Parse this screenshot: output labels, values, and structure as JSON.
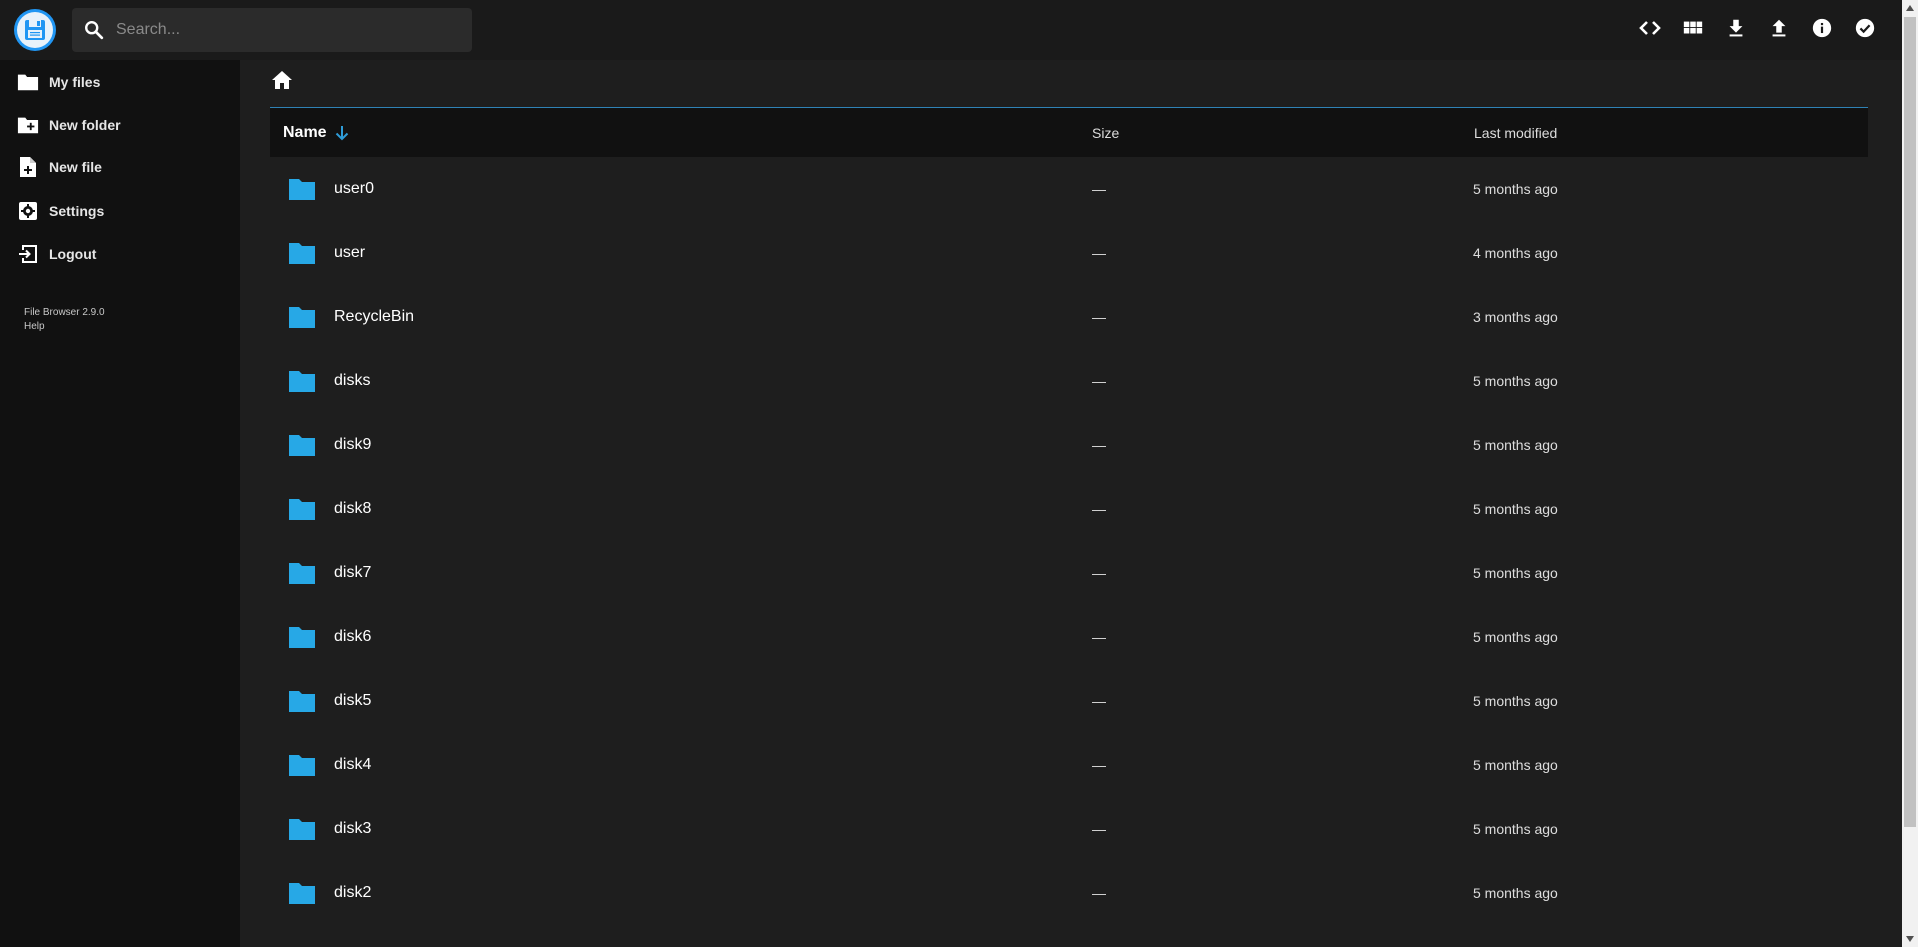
{
  "app": {
    "logo_icon": "floppy-disk-logo",
    "accent_color": "#2196f3",
    "folder_color": "#27a8e6"
  },
  "search": {
    "placeholder": "Search..."
  },
  "header_actions": [
    {
      "name": "toggle-code-view",
      "icon": "code-icon"
    },
    {
      "name": "switch-view",
      "icon": "grid-view-icon"
    },
    {
      "name": "download",
      "icon": "download-icon"
    },
    {
      "name": "upload",
      "icon": "upload-icon"
    },
    {
      "name": "info",
      "icon": "info-icon"
    },
    {
      "name": "select-multiple",
      "icon": "check-circle-icon"
    }
  ],
  "sidebar": {
    "items": [
      {
        "label": "My files",
        "icon": "folder-icon"
      },
      {
        "label": "New folder",
        "icon": "new-folder-icon"
      },
      {
        "label": "New file",
        "icon": "new-file-icon"
      },
      {
        "label": "Settings",
        "icon": "settings-icon"
      },
      {
        "label": "Logout",
        "icon": "logout-icon"
      }
    ],
    "credits": {
      "version": "File Browser 2.9.0",
      "help": "Help"
    }
  },
  "breadcrumb": {
    "home_icon": "home-icon"
  },
  "listing": {
    "columns": {
      "name": "Name",
      "size": "Size",
      "modified": "Last modified"
    },
    "sort": {
      "column": "name",
      "direction": "desc"
    },
    "rows": [
      {
        "name": "user0",
        "size": "—",
        "modified": "5 months ago"
      },
      {
        "name": "user",
        "size": "—",
        "modified": "4 months ago"
      },
      {
        "name": "RecycleBin",
        "size": "—",
        "modified": "3 months ago"
      },
      {
        "name": "disks",
        "size": "—",
        "modified": "5 months ago"
      },
      {
        "name": "disk9",
        "size": "—",
        "modified": "5 months ago"
      },
      {
        "name": "disk8",
        "size": "—",
        "modified": "5 months ago"
      },
      {
        "name": "disk7",
        "size": "—",
        "modified": "5 months ago"
      },
      {
        "name": "disk6",
        "size": "—",
        "modified": "5 months ago"
      },
      {
        "name": "disk5",
        "size": "—",
        "modified": "5 months ago"
      },
      {
        "name": "disk4",
        "size": "—",
        "modified": "5 months ago"
      },
      {
        "name": "disk3",
        "size": "—",
        "modified": "5 months ago"
      },
      {
        "name": "disk2",
        "size": "—",
        "modified": "5 months ago"
      }
    ]
  }
}
